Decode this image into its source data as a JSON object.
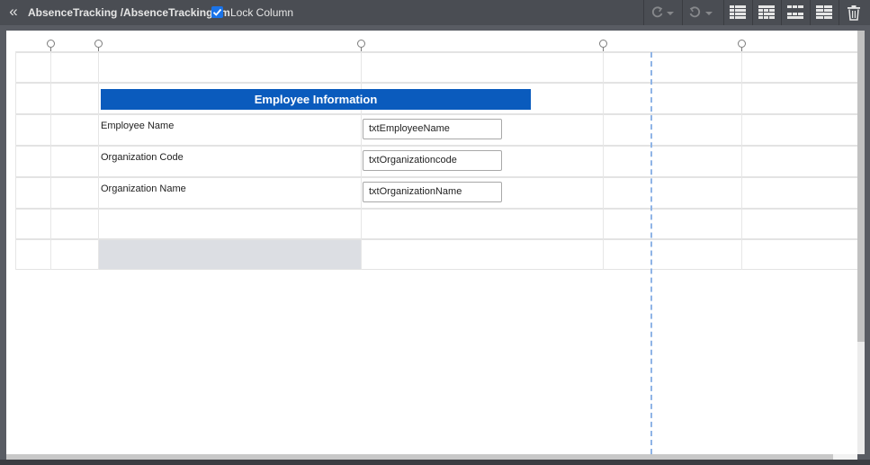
{
  "topbar": {
    "collapse_glyph": "«",
    "breadcrumb": "AbsenceTracking /AbsenceTrackingfrm",
    "lock_column_label": "Lock Column",
    "lock_column_checked": true,
    "icons": [
      "collapse-icon",
      "redo-icon",
      "undo-icon",
      "layout-grid-icon",
      "layout-grid-icon",
      "layout-grid-icon",
      "layout-grid-icon",
      "trash-icon"
    ]
  },
  "form": {
    "section_title": "Employee Information",
    "fields": [
      {
        "label": "Employee Name",
        "value": "txtEmployeeName"
      },
      {
        "label": "Organization Code",
        "value": "txtOrganizationcode"
      },
      {
        "label": "Organization Name",
        "value": "txtOrganizationName"
      }
    ]
  },
  "colors": {
    "section_header_bg": "#0a5bbd",
    "toolbar_bg": "#4a4d53",
    "checkbox_accent": "#1a73e8",
    "guide_line": "#8fb4e6"
  }
}
